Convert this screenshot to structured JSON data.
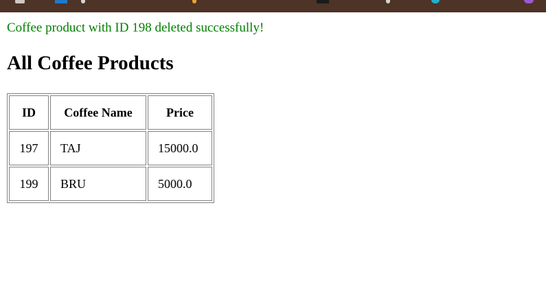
{
  "message": "Coffee product with ID 198 deleted successfully!",
  "heading": "All Coffee Products",
  "table": {
    "headers": [
      "ID",
      "Coffee Name",
      "Price"
    ],
    "rows": [
      [
        "197",
        "TAJ",
        "15000.0"
      ],
      [
        "199",
        "BRU",
        "5000.0"
      ]
    ]
  },
  "taskbar_icons": [
    "app-icon",
    "blue-app-icon",
    "app-icon",
    "yellow-app-icon",
    "dark-app-icon",
    "app-icon",
    "teal-app-icon",
    "purple-app-icon"
  ]
}
